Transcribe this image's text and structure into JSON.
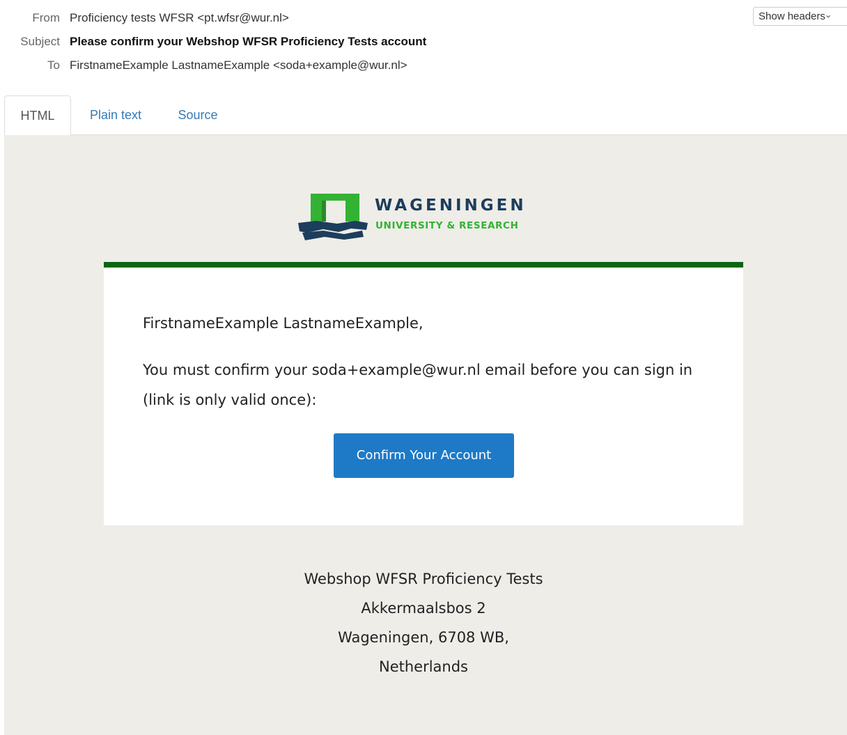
{
  "email_headers": {
    "from_label": "From",
    "from_value": "Proficiency tests WFSR <pt.wfsr@wur.nl>",
    "subject_label": "Subject",
    "subject_value": "Please confirm your Webshop WFSR Proficiency Tests account",
    "to_label": "To",
    "to_value": "FirstnameExample LastnameExample <soda+example@wur.nl>",
    "show_headers_label": "Show headers"
  },
  "tabs": [
    {
      "label": "HTML",
      "active": true
    },
    {
      "label": "Plain text",
      "active": false
    },
    {
      "label": "Source",
      "active": false
    }
  ],
  "email_body": {
    "logo": {
      "name": "WAGENINGEN",
      "subtitle": "UNIVERSITY & RESEARCH",
      "colors": {
        "green": "#34b233",
        "navy": "#1d3d5c"
      }
    },
    "greeting": "FirstnameExample LastnameExample,",
    "message": "You must confirm your soda+example@wur.nl email before you can sign in (link is only valid once):",
    "confirm_button": "Confirm Your Account",
    "footer": {
      "line1": "Webshop WFSR Proficiency Tests",
      "line2": "Akkermaalsbos 2",
      "line3": "Wageningen, 6708 WB,",
      "line4": "Netherlands"
    }
  },
  "colors": {
    "accent_bar": "#0b6613",
    "button": "#1e7ac6",
    "body_background": "#eeede8",
    "link": "#337ab7"
  }
}
